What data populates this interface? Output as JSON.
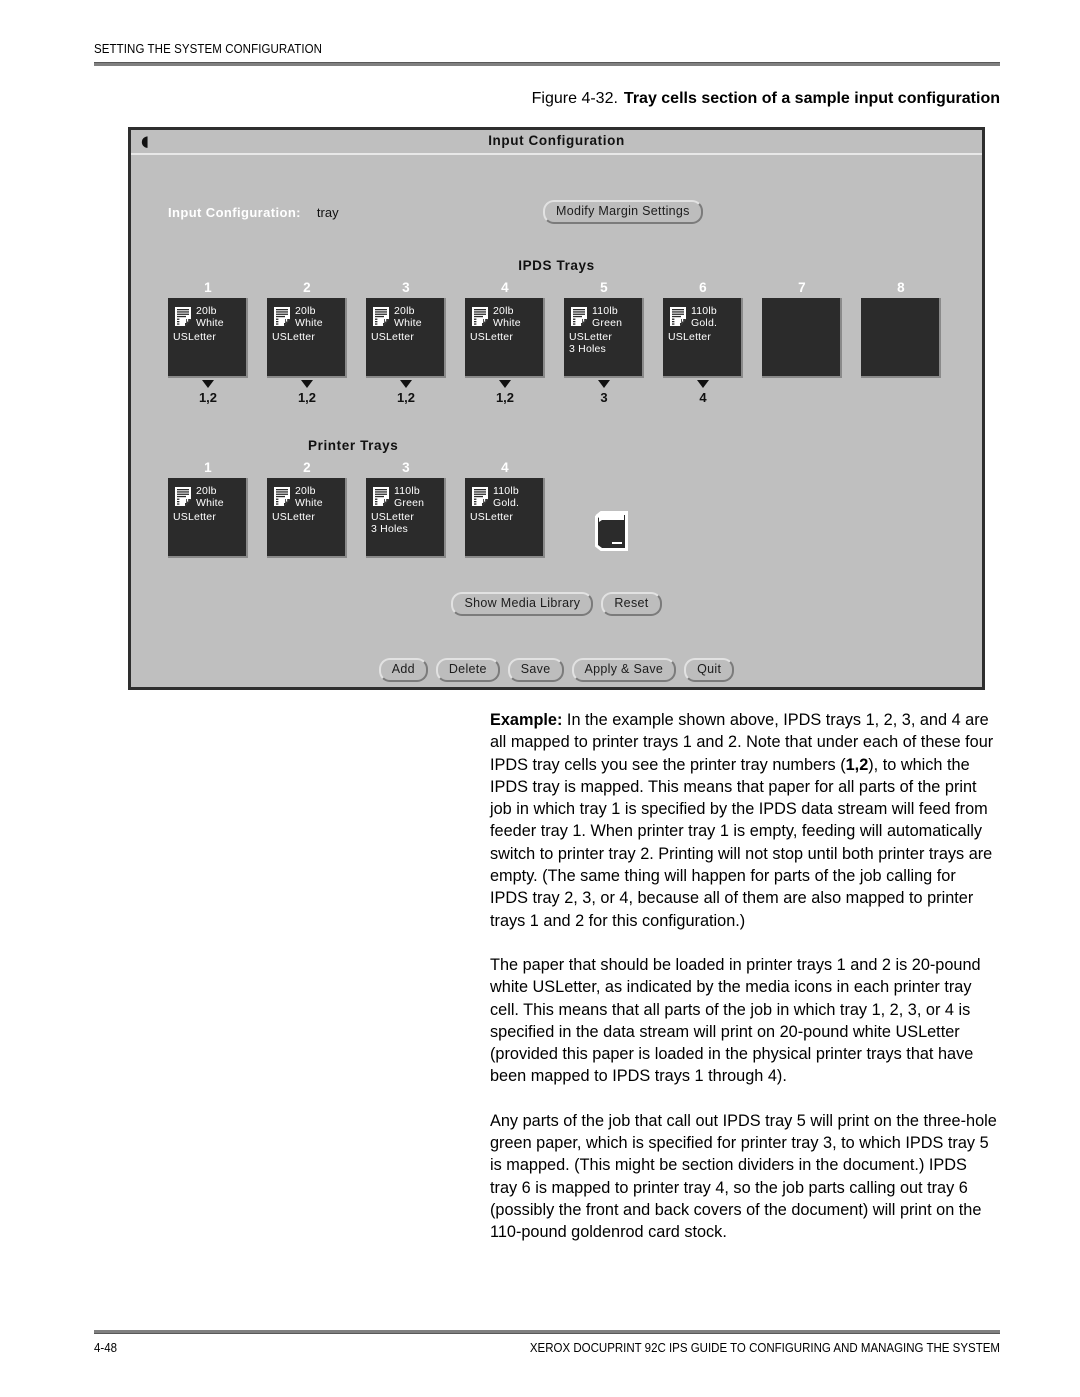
{
  "page": {
    "running_head": "SETTING THE SYSTEM CONFIGURATION",
    "footer_page_number": "4-48",
    "footer_title": "XEROX DOCUPRINT 92C IPS GUIDE TO CONFIGURING AND MANAGING THE SYSTEM"
  },
  "figure": {
    "number": "Figure 4-32.",
    "title": "Tray cells section of a sample input configuration"
  },
  "dialog": {
    "titlebar": {
      "title": "Input Configuration",
      "menu_icon": "window-menu-icon"
    },
    "config": {
      "label": "Input Configuration:",
      "value": "tray"
    },
    "modify_margin_button": "Modify Margin Settings",
    "ipds_section_title": "IPDS Trays",
    "printer_section_title": "Printer Trays",
    "ipds_trays": [
      {
        "number": "1",
        "weight": "20lb",
        "color": "White",
        "size": "USLetter",
        "extra": "",
        "mapping": "1,2",
        "empty": false
      },
      {
        "number": "2",
        "weight": "20lb",
        "color": "White",
        "size": "USLetter",
        "extra": "",
        "mapping": "1,2",
        "empty": false
      },
      {
        "number": "3",
        "weight": "20lb",
        "color": "White",
        "size": "USLetter",
        "extra": "",
        "mapping": "1,2",
        "empty": false
      },
      {
        "number": "4",
        "weight": "20lb",
        "color": "White",
        "size": "USLetter",
        "extra": "",
        "mapping": "1,2",
        "empty": false
      },
      {
        "number": "5",
        "weight": "110lb",
        "color": "Green",
        "size": "USLetter",
        "extra": "3 Holes",
        "mapping": "3",
        "empty": false
      },
      {
        "number": "6",
        "weight": "110lb",
        "color": "Gold.",
        "size": "USLetter",
        "extra": "",
        "mapping": "4",
        "empty": false
      },
      {
        "number": "7",
        "weight": "",
        "color": "",
        "size": "",
        "extra": "",
        "mapping": "",
        "empty": true
      },
      {
        "number": "8",
        "weight": "",
        "color": "",
        "size": "",
        "extra": "",
        "mapping": "",
        "empty": true
      }
    ],
    "printer_trays": [
      {
        "number": "1",
        "weight": "20lb",
        "color": "White",
        "size": "USLetter",
        "extra": ""
      },
      {
        "number": "2",
        "weight": "20lb",
        "color": "White",
        "size": "USLetter",
        "extra": ""
      },
      {
        "number": "3",
        "weight": "110lb",
        "color": "Green",
        "size": "USLetter",
        "extra": "3 Holes"
      },
      {
        "number": "4",
        "weight": "110lb",
        "color": "Gold.",
        "size": "USLetter",
        "extra": ""
      }
    ],
    "media_library_icon": "book-icon",
    "media_buttons": [
      {
        "label": "Show Media Library"
      },
      {
        "label": "Reset"
      }
    ],
    "main_buttons": [
      {
        "label": "Add"
      },
      {
        "label": "Delete"
      },
      {
        "label": "Save"
      },
      {
        "label": "Apply & Save"
      },
      {
        "label": "Quit"
      }
    ]
  },
  "body": {
    "p1_lead": "Example:",
    "p1_rest_a": " In the example shown above, IPDS trays 1, 2, 3, and 4 are all mapped to printer trays 1 and 2. Note that under each of these four IPDS tray cells you see the printer tray numbers (",
    "p1_bold": "1,2",
    "p1_rest_b": "), to which the IPDS tray is mapped. This means that paper for all parts of the print job in which tray 1 is specified by the IPDS data stream will feed from feeder tray 1. When printer tray 1 is empty, feeding will automatically switch to printer tray 2. Printing will not stop until both printer trays are empty. (The same thing will happen for parts of the job calling for IPDS tray 2, 3, or 4, because all of them are also mapped to printer trays 1 and 2 for this configuration.)",
    "p2": "The paper that should be loaded in printer trays 1 and 2 is 20-pound white USLetter, as indicated by the media icons in each printer tray cell. This means that all parts of the job in which tray 1, 2, 3, or 4 is specified in the data stream will print on 20-pound white USLetter (provided this paper is loaded in the physical printer trays that have been mapped to IPDS trays 1 through 4).",
    "p3": "Any parts of the job that call out IPDS tray 5 will print on the three-hole green paper, which is specified for printer tray 3, to which IPDS tray 5 is mapped. (This might be section dividers in the document.) IPDS tray 6 is mapped to printer tray 4, so the job parts calling out tray 6 (possibly the front and back covers of the document) will print on the 110-pound goldenrod card stock."
  },
  "colors": {
    "dialog_bg": "#bfbfbf",
    "dialog_border": "#2e2e2e",
    "tray_cell_bg": "#2b2b2b",
    "rule_gray": "#808080"
  }
}
